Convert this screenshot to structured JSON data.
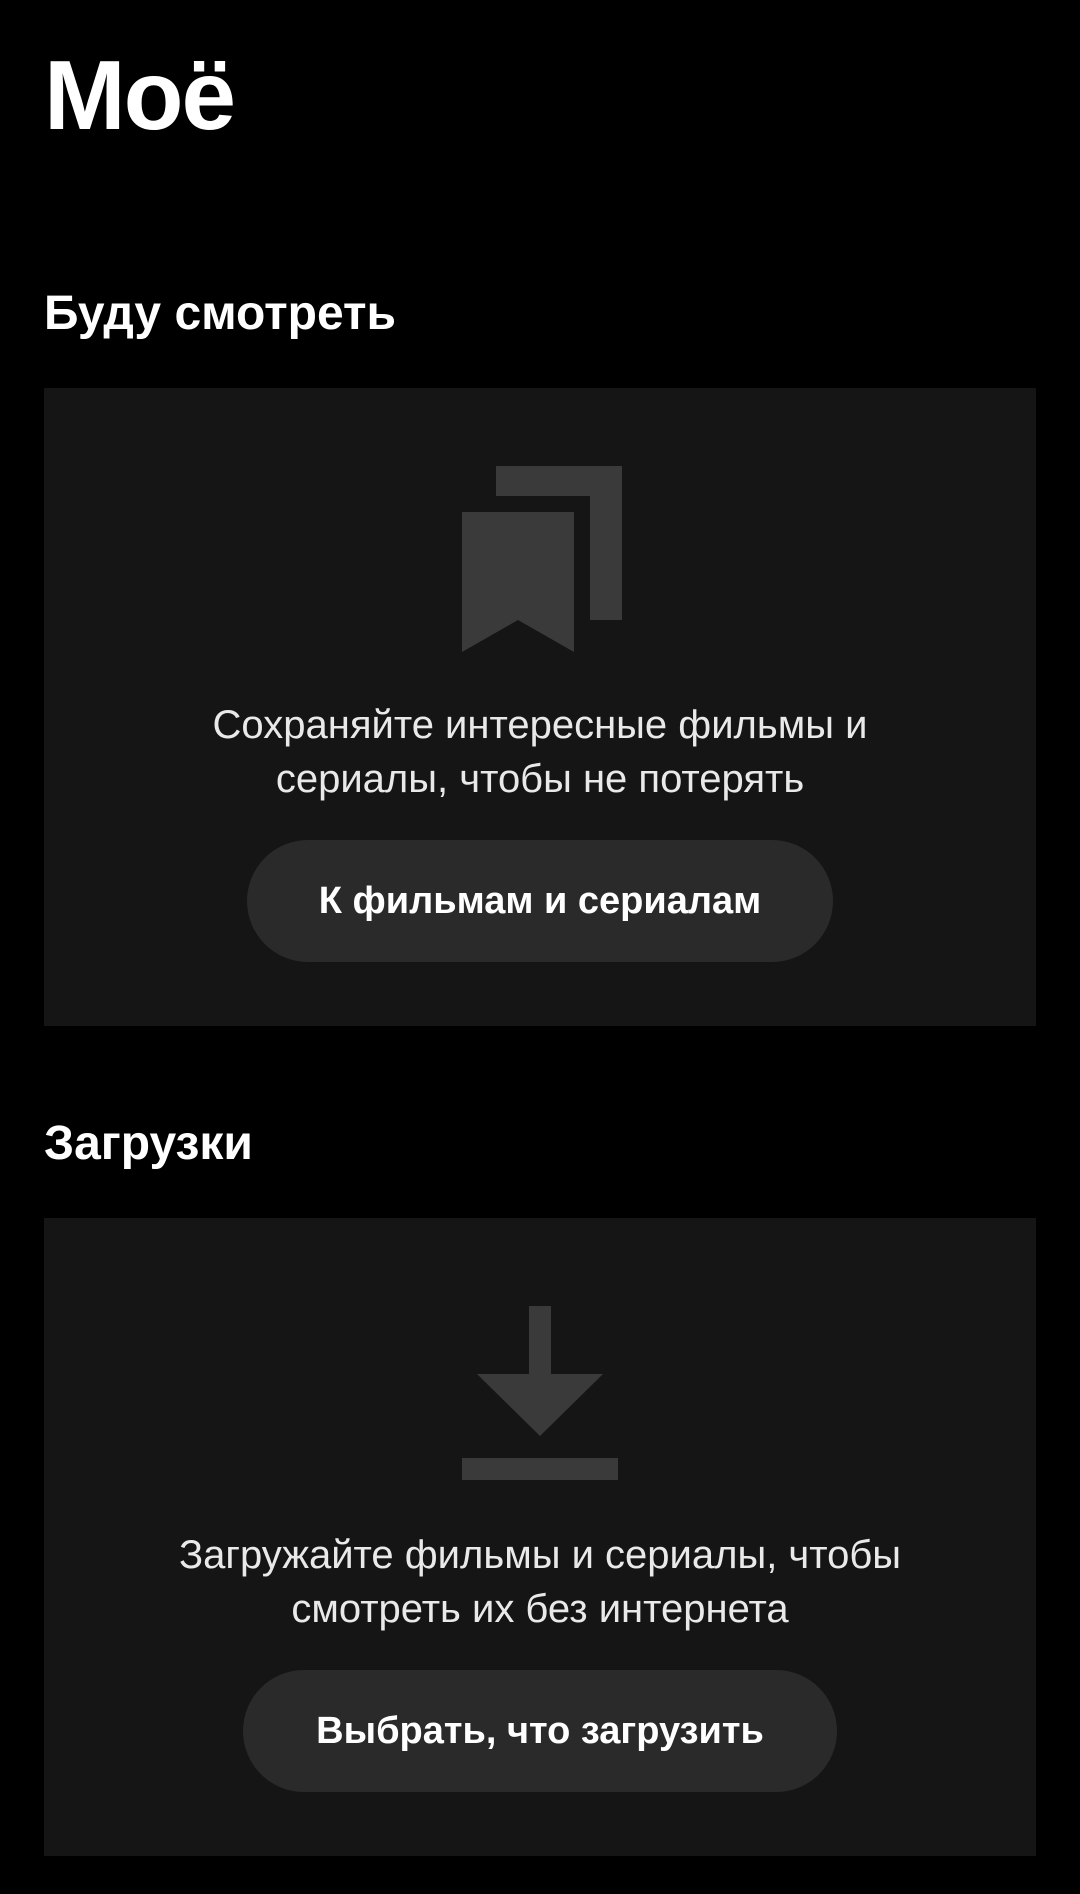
{
  "page": {
    "title": "Моё"
  },
  "watchlist": {
    "title": "Буду смотреть",
    "icon": "bookmarks-icon",
    "text_line1": "Сохраняйте интересные фильмы и",
    "text_line2": "сериалы, чтобы не потерять",
    "button_label": "К фильмам и сериалам"
  },
  "downloads": {
    "title": "Загрузки",
    "icon": "download-icon",
    "text_line1": "Загружайте фильмы и сериалы, чтобы",
    "text_line2": "смотреть их без интернета",
    "button_label": "Выбрать, что загрузить"
  },
  "colors": {
    "background": "#000000",
    "card": "#151515",
    "button": "#2a2a2a",
    "icon": "#3a3a3a",
    "text": "#ffffff"
  }
}
